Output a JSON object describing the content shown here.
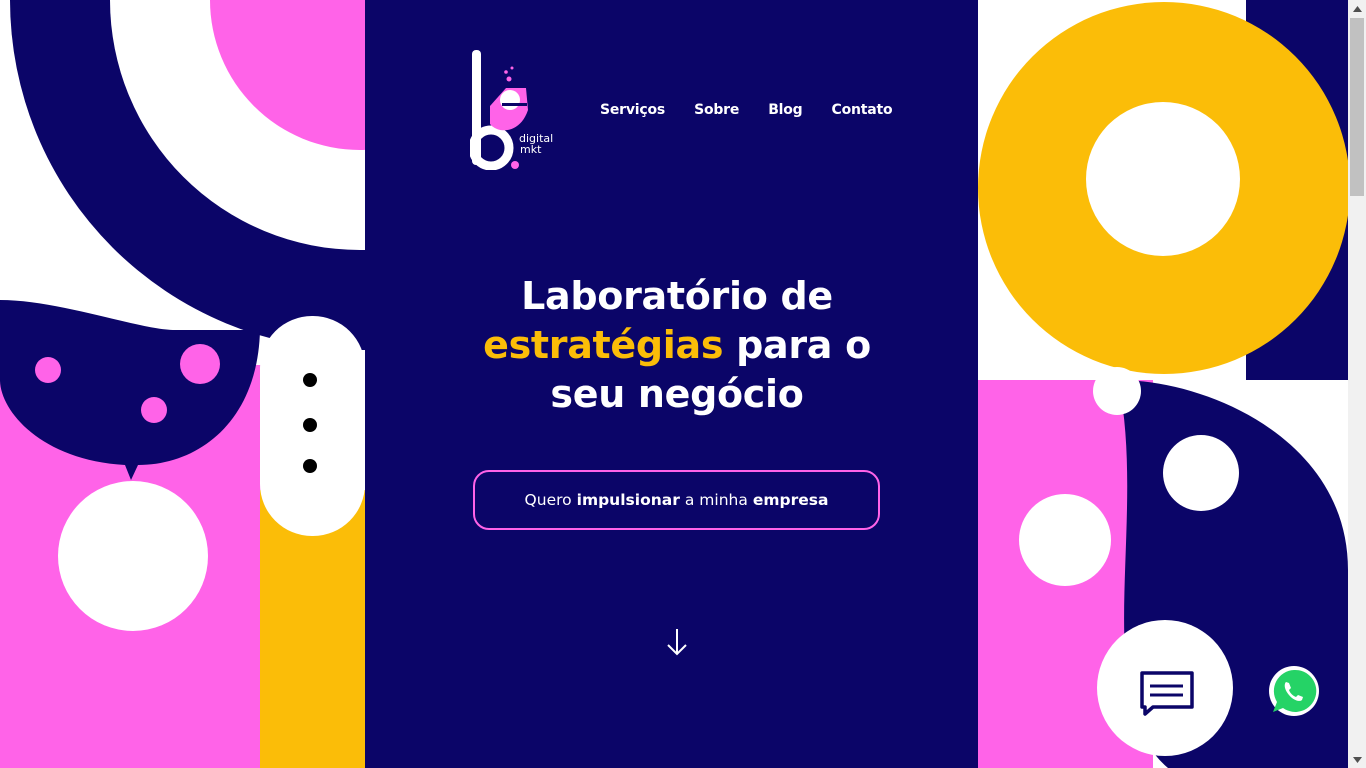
{
  "brand": {
    "logo_line1": "digital",
    "logo_line2": "mkt"
  },
  "nav": {
    "items": [
      "Serviços",
      "Sobre",
      "Blog",
      "Contato"
    ]
  },
  "hero": {
    "line1": "Laboratório de",
    "accent": "estratégias",
    "line2_rest": "para o",
    "line3": "seu negócio"
  },
  "cta": {
    "pre": "Quero",
    "bold1": "impulsionar",
    "mid": "a minha",
    "bold2": "empresa"
  },
  "icons": {
    "scroll_down": "arrow-down-icon",
    "chat": "chat-bubble-icon",
    "whatsapp": "whatsapp-icon"
  },
  "colors": {
    "navy": "#0b0568",
    "pink": "#ff63e8",
    "yellow": "#fbbd08",
    "white": "#ffffff",
    "whatsapp": "#25d366"
  }
}
